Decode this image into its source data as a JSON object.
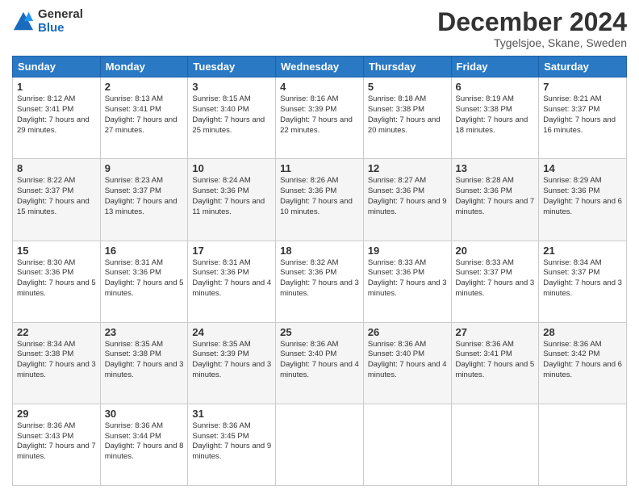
{
  "logo": {
    "general": "General",
    "blue": "Blue"
  },
  "title": "December 2024",
  "location": "Tygelsjoe, Skane, Sweden",
  "days_of_week": [
    "Sunday",
    "Monday",
    "Tuesday",
    "Wednesday",
    "Thursday",
    "Friday",
    "Saturday"
  ],
  "weeks": [
    [
      {
        "day": "1",
        "sunrise": "Sunrise: 8:12 AM",
        "sunset": "Sunset: 3:41 PM",
        "daylight": "Daylight: 7 hours and 29 minutes."
      },
      {
        "day": "2",
        "sunrise": "Sunrise: 8:13 AM",
        "sunset": "Sunset: 3:41 PM",
        "daylight": "Daylight: 7 hours and 27 minutes."
      },
      {
        "day": "3",
        "sunrise": "Sunrise: 8:15 AM",
        "sunset": "Sunset: 3:40 PM",
        "daylight": "Daylight: 7 hours and 25 minutes."
      },
      {
        "day": "4",
        "sunrise": "Sunrise: 8:16 AM",
        "sunset": "Sunset: 3:39 PM",
        "daylight": "Daylight: 7 hours and 22 minutes."
      },
      {
        "day": "5",
        "sunrise": "Sunrise: 8:18 AM",
        "sunset": "Sunset: 3:38 PM",
        "daylight": "Daylight: 7 hours and 20 minutes."
      },
      {
        "day": "6",
        "sunrise": "Sunrise: 8:19 AM",
        "sunset": "Sunset: 3:38 PM",
        "daylight": "Daylight: 7 hours and 18 minutes."
      },
      {
        "day": "7",
        "sunrise": "Sunrise: 8:21 AM",
        "sunset": "Sunset: 3:37 PM",
        "daylight": "Daylight: 7 hours and 16 minutes."
      }
    ],
    [
      {
        "day": "8",
        "sunrise": "Sunrise: 8:22 AM",
        "sunset": "Sunset: 3:37 PM",
        "daylight": "Daylight: 7 hours and 15 minutes."
      },
      {
        "day": "9",
        "sunrise": "Sunrise: 8:23 AM",
        "sunset": "Sunset: 3:37 PM",
        "daylight": "Daylight: 7 hours and 13 minutes."
      },
      {
        "day": "10",
        "sunrise": "Sunrise: 8:24 AM",
        "sunset": "Sunset: 3:36 PM",
        "daylight": "Daylight: 7 hours and 11 minutes."
      },
      {
        "day": "11",
        "sunrise": "Sunrise: 8:26 AM",
        "sunset": "Sunset: 3:36 PM",
        "daylight": "Daylight: 7 hours and 10 minutes."
      },
      {
        "day": "12",
        "sunrise": "Sunrise: 8:27 AM",
        "sunset": "Sunset: 3:36 PM",
        "daylight": "Daylight: 7 hours and 9 minutes."
      },
      {
        "day": "13",
        "sunrise": "Sunrise: 8:28 AM",
        "sunset": "Sunset: 3:36 PM",
        "daylight": "Daylight: 7 hours and 7 minutes."
      },
      {
        "day": "14",
        "sunrise": "Sunrise: 8:29 AM",
        "sunset": "Sunset: 3:36 PM",
        "daylight": "Daylight: 7 hours and 6 minutes."
      }
    ],
    [
      {
        "day": "15",
        "sunrise": "Sunrise: 8:30 AM",
        "sunset": "Sunset: 3:36 PM",
        "daylight": "Daylight: 7 hours and 5 minutes."
      },
      {
        "day": "16",
        "sunrise": "Sunrise: 8:31 AM",
        "sunset": "Sunset: 3:36 PM",
        "daylight": "Daylight: 7 hours and 5 minutes."
      },
      {
        "day": "17",
        "sunrise": "Sunrise: 8:31 AM",
        "sunset": "Sunset: 3:36 PM",
        "daylight": "Daylight: 7 hours and 4 minutes."
      },
      {
        "day": "18",
        "sunrise": "Sunrise: 8:32 AM",
        "sunset": "Sunset: 3:36 PM",
        "daylight": "Daylight: 7 hours and 3 minutes."
      },
      {
        "day": "19",
        "sunrise": "Sunrise: 8:33 AM",
        "sunset": "Sunset: 3:36 PM",
        "daylight": "Daylight: 7 hours and 3 minutes."
      },
      {
        "day": "20",
        "sunrise": "Sunrise: 8:33 AM",
        "sunset": "Sunset: 3:37 PM",
        "daylight": "Daylight: 7 hours and 3 minutes."
      },
      {
        "day": "21",
        "sunrise": "Sunrise: 8:34 AM",
        "sunset": "Sunset: 3:37 PM",
        "daylight": "Daylight: 7 hours and 3 minutes."
      }
    ],
    [
      {
        "day": "22",
        "sunrise": "Sunrise: 8:34 AM",
        "sunset": "Sunset: 3:38 PM",
        "daylight": "Daylight: 7 hours and 3 minutes."
      },
      {
        "day": "23",
        "sunrise": "Sunrise: 8:35 AM",
        "sunset": "Sunset: 3:38 PM",
        "daylight": "Daylight: 7 hours and 3 minutes."
      },
      {
        "day": "24",
        "sunrise": "Sunrise: 8:35 AM",
        "sunset": "Sunset: 3:39 PM",
        "daylight": "Daylight: 7 hours and 3 minutes."
      },
      {
        "day": "25",
        "sunrise": "Sunrise: 8:36 AM",
        "sunset": "Sunset: 3:40 PM",
        "daylight": "Daylight: 7 hours and 4 minutes."
      },
      {
        "day": "26",
        "sunrise": "Sunrise: 8:36 AM",
        "sunset": "Sunset: 3:40 PM",
        "daylight": "Daylight: 7 hours and 4 minutes."
      },
      {
        "day": "27",
        "sunrise": "Sunrise: 8:36 AM",
        "sunset": "Sunset: 3:41 PM",
        "daylight": "Daylight: 7 hours and 5 minutes."
      },
      {
        "day": "28",
        "sunrise": "Sunrise: 8:36 AM",
        "sunset": "Sunset: 3:42 PM",
        "daylight": "Daylight: 7 hours and 6 minutes."
      }
    ],
    [
      {
        "day": "29",
        "sunrise": "Sunrise: 8:36 AM",
        "sunset": "Sunset: 3:43 PM",
        "daylight": "Daylight: 7 hours and 7 minutes."
      },
      {
        "day": "30",
        "sunrise": "Sunrise: 8:36 AM",
        "sunset": "Sunset: 3:44 PM",
        "daylight": "Daylight: 7 hours and 8 minutes."
      },
      {
        "day": "31",
        "sunrise": "Sunrise: 8:36 AM",
        "sunset": "Sunset: 3:45 PM",
        "daylight": "Daylight: 7 hours and 9 minutes."
      },
      null,
      null,
      null,
      null
    ]
  ]
}
